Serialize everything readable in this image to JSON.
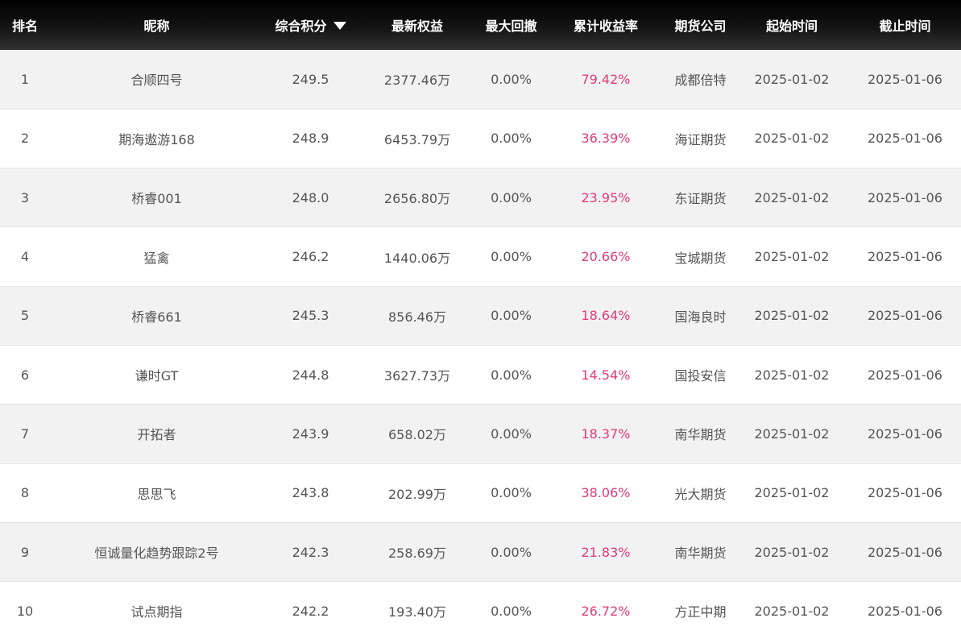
{
  "table": {
    "headers": {
      "rank": "排名",
      "nickname": "昵称",
      "score": "综合积分",
      "equity": "最新权益",
      "drawdown": "最大回撤",
      "return_rate": "累计收益率",
      "broker": "期货公司",
      "start": "起始时间",
      "end": "截止时间"
    },
    "sort": {
      "column": "综合积分",
      "direction": "desc",
      "arrow_icon": "triangle-down-icon"
    },
    "accent_color": "#e6397a",
    "rows": [
      {
        "rank": "1",
        "nickname": "合顺四号",
        "score": "249.5",
        "equity": "2377.46万",
        "drawdown": "0.00%",
        "return_rate": "79.42%",
        "broker": "成都倍特",
        "start": "2025-01-02",
        "end": "2025-01-06"
      },
      {
        "rank": "2",
        "nickname": "期海遨游168",
        "score": "248.9",
        "equity": "6453.79万",
        "drawdown": "0.00%",
        "return_rate": "36.39%",
        "broker": "海证期货",
        "start": "2025-01-02",
        "end": "2025-01-06"
      },
      {
        "rank": "3",
        "nickname": "桥睿001",
        "score": "248.0",
        "equity": "2656.80万",
        "drawdown": "0.00%",
        "return_rate": "23.95%",
        "broker": "东证期货",
        "start": "2025-01-02",
        "end": "2025-01-06"
      },
      {
        "rank": "4",
        "nickname": "猛禽",
        "score": "246.2",
        "equity": "1440.06万",
        "drawdown": "0.00%",
        "return_rate": "20.66%",
        "broker": "宝城期货",
        "start": "2025-01-02",
        "end": "2025-01-06"
      },
      {
        "rank": "5",
        "nickname": "桥睿661",
        "score": "245.3",
        "equity": "856.46万",
        "drawdown": "0.00%",
        "return_rate": "18.64%",
        "broker": "国海良时",
        "start": "2025-01-02",
        "end": "2025-01-06"
      },
      {
        "rank": "6",
        "nickname": "谦时GT",
        "score": "244.8",
        "equity": "3627.73万",
        "drawdown": "0.00%",
        "return_rate": "14.54%",
        "broker": "国投安信",
        "start": "2025-01-02",
        "end": "2025-01-06"
      },
      {
        "rank": "7",
        "nickname": "开拓者",
        "score": "243.9",
        "equity": "658.02万",
        "drawdown": "0.00%",
        "return_rate": "18.37%",
        "broker": "南华期货",
        "start": "2025-01-02",
        "end": "2025-01-06"
      },
      {
        "rank": "8",
        "nickname": "思思飞",
        "score": "243.8",
        "equity": "202.99万",
        "drawdown": "0.00%",
        "return_rate": "38.06%",
        "broker": "光大期货",
        "start": "2025-01-02",
        "end": "2025-01-06"
      },
      {
        "rank": "9",
        "nickname": "恒诚量化趋势跟踪2号",
        "score": "242.3",
        "equity": "258.69万",
        "drawdown": "0.00%",
        "return_rate": "21.83%",
        "broker": "南华期货",
        "start": "2025-01-02",
        "end": "2025-01-06"
      },
      {
        "rank": "10",
        "nickname": "试点期指",
        "score": "242.2",
        "equity": "193.40万",
        "drawdown": "0.00%",
        "return_rate": "26.72%",
        "broker": "方正中期",
        "start": "2025-01-02",
        "end": "2025-01-06"
      }
    ]
  }
}
